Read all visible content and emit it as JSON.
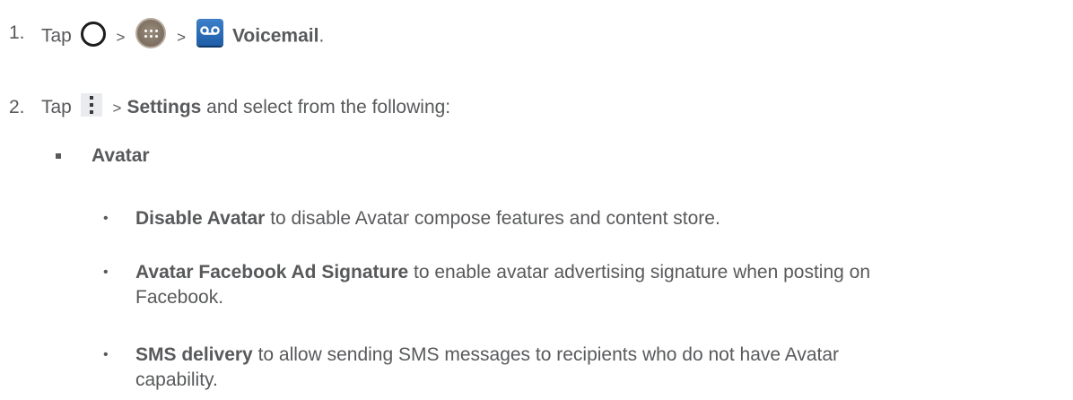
{
  "steps": [
    {
      "number": "1.",
      "tap": "Tap",
      "sep1": ">",
      "sep2": ">",
      "target": "Voicemail",
      "end": ".",
      "icons": [
        "home-icon",
        "apps-icon",
        "voicemail-icon"
      ]
    },
    {
      "number": "2.",
      "tap": "Tap",
      "sep": ">",
      "target": "Settings",
      "rest": " and select from the following:",
      "icons": [
        "menu-icon"
      ]
    }
  ],
  "section": {
    "title": "Avatar",
    "items": [
      {
        "term": "Disable Avatar",
        "desc": " to disable Avatar compose features and content store."
      },
      {
        "term": "Avatar Facebook Ad Signature",
        "desc": " to enable avatar advertising signature when posting on",
        "desc2": "Facebook."
      },
      {
        "term": "SMS delivery",
        "desc": " to allow sending SMS messages to recipients who do not have Avatar",
        "desc2": "capability."
      }
    ]
  }
}
